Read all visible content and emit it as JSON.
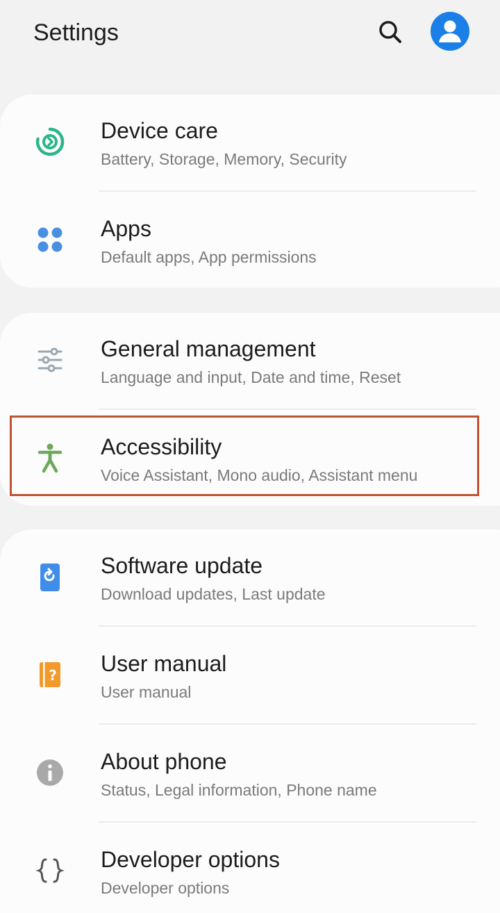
{
  "header": {
    "title": "Settings",
    "search_icon": "search-icon",
    "avatar_icon": "account-icon",
    "avatar_color": "#1a7fe6"
  },
  "groups": [
    {
      "items": [
        {
          "title": "Device care",
          "subtitle": "Battery, Storage, Memory, Security",
          "icon": "device-care-icon",
          "icon_color": "#2bb58a"
        },
        {
          "title": "Apps",
          "subtitle": "Default apps, App permissions",
          "icon": "apps-icon",
          "icon_color": "#4a90e2"
        }
      ]
    },
    {
      "items": [
        {
          "title": "General management",
          "subtitle": "Language and input, Date and time, Reset",
          "icon": "sliders-icon",
          "icon_color": "#9aa7b3"
        },
        {
          "title": "Accessibility",
          "subtitle": "Voice Assistant, Mono audio, Assistant menu",
          "icon": "accessibility-icon",
          "icon_color": "#6ca85a",
          "highlighted": true
        }
      ]
    },
    {
      "items": [
        {
          "title": "Software update",
          "subtitle": "Download updates, Last update",
          "icon": "software-update-icon",
          "icon_color": "#3f8de8"
        },
        {
          "title": "User manual",
          "subtitle": "User manual",
          "icon": "user-manual-icon",
          "icon_color": "#f39a2b"
        },
        {
          "title": "About phone",
          "subtitle": "Status, Legal information, Phone name",
          "icon": "info-icon",
          "icon_color": "#a9a9a9"
        },
        {
          "title": "Developer options",
          "subtitle": "Developer options",
          "icon": "developer-options-icon",
          "icon_color": "#555555"
        }
      ]
    }
  ],
  "highlight_color": "#c0532f"
}
